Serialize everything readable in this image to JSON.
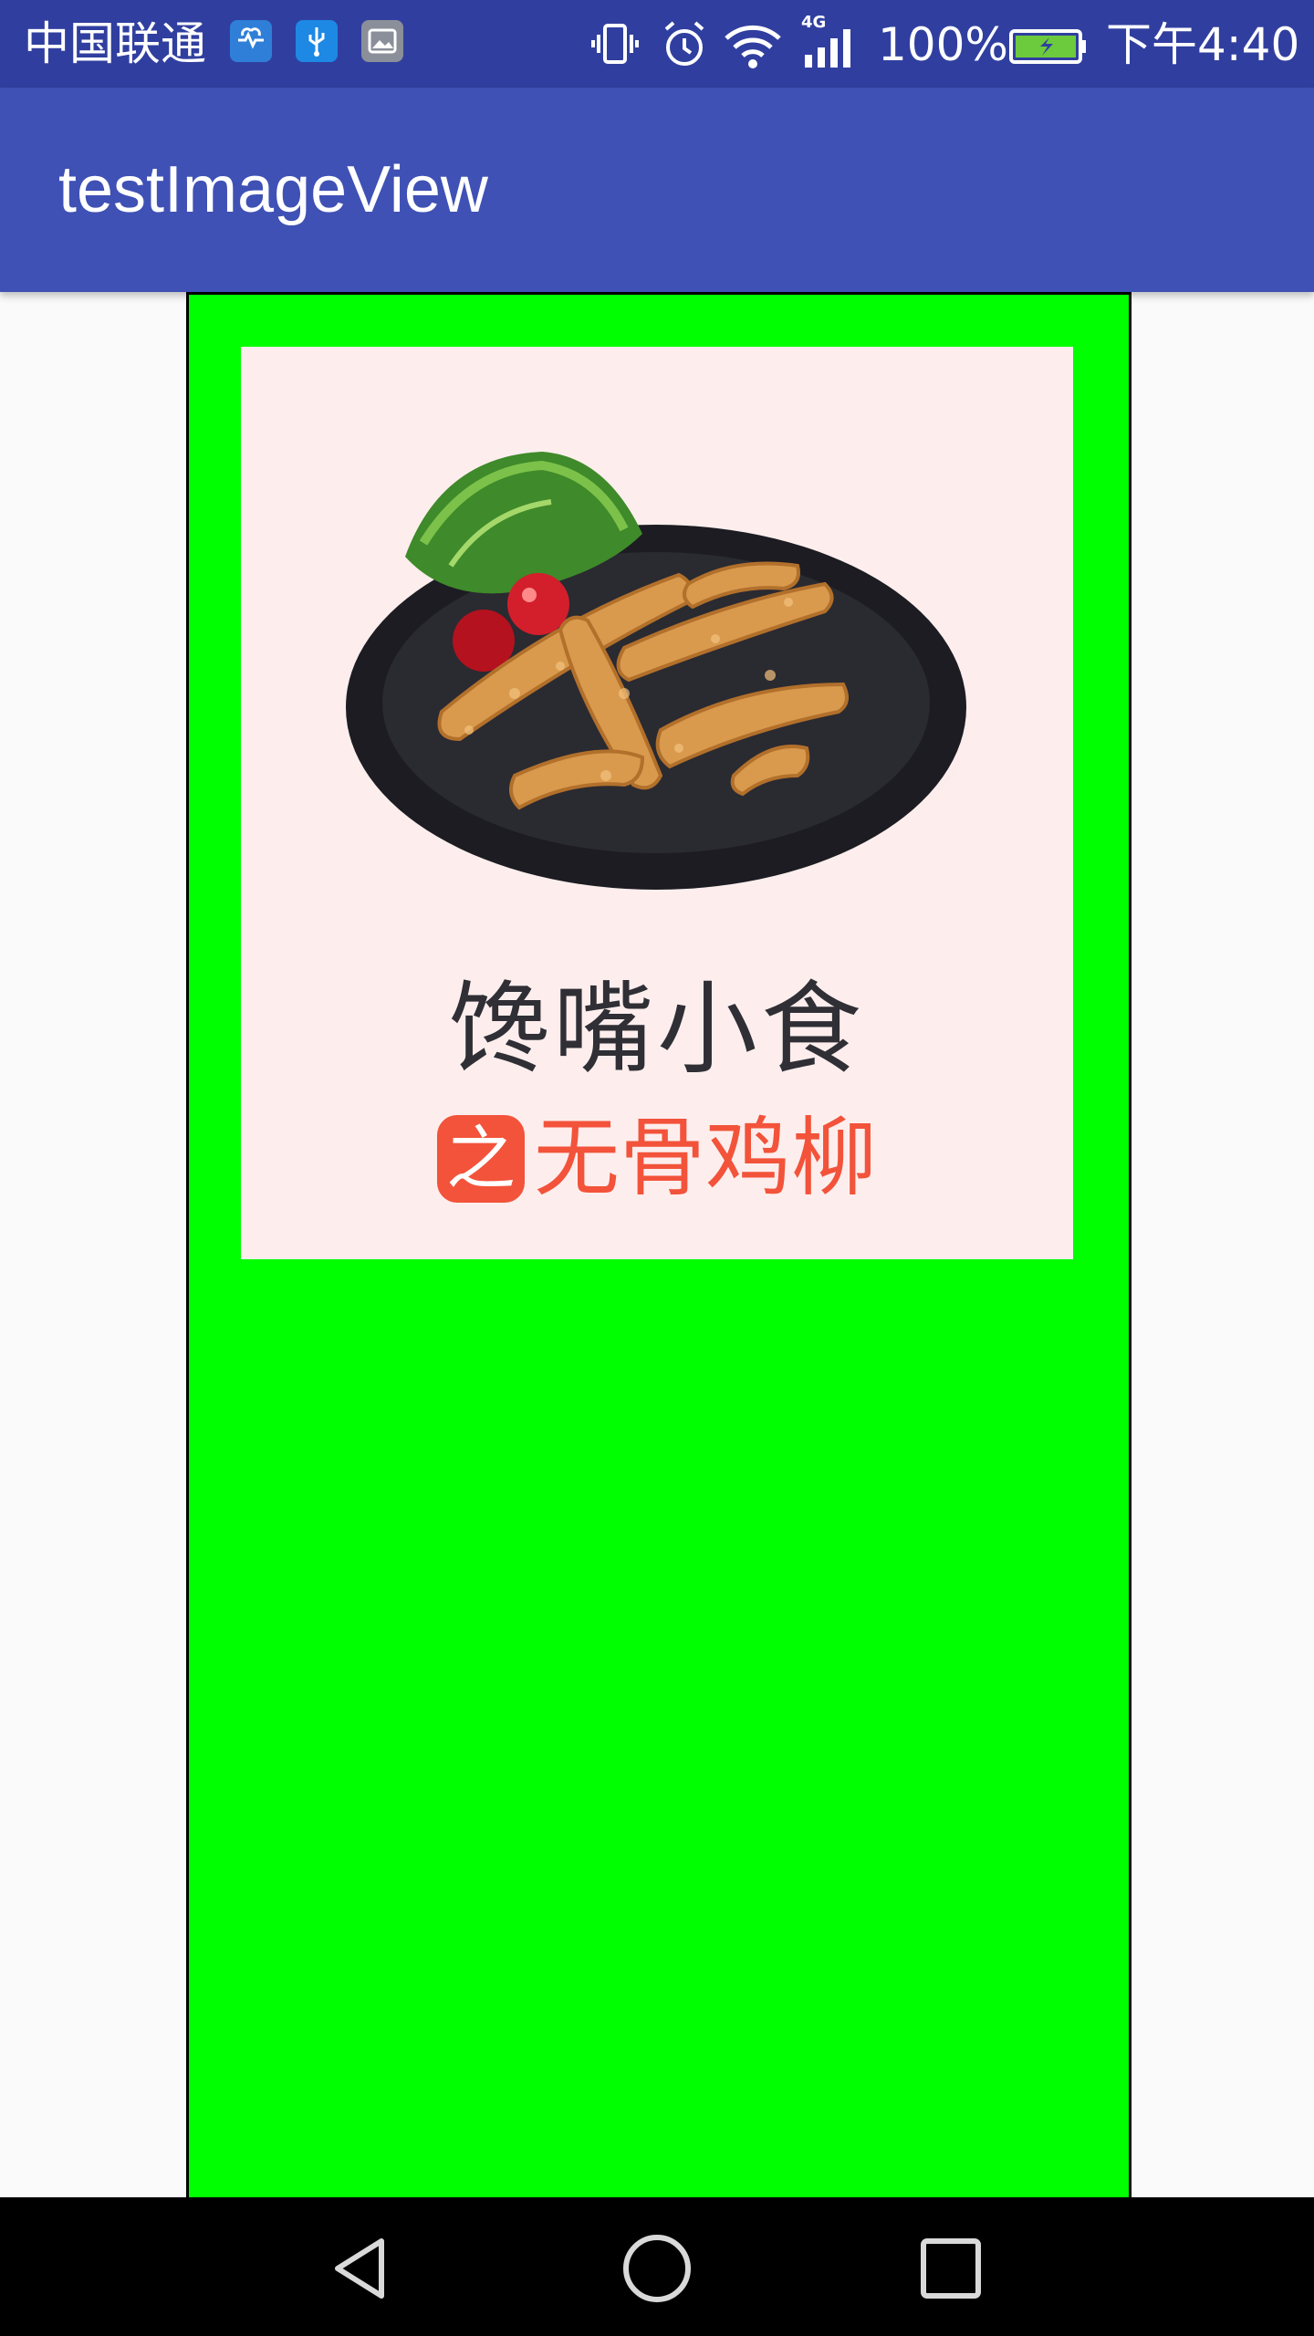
{
  "status_bar": {
    "carrier": "中国联通",
    "battery": "100%",
    "time": "下午4:40",
    "network": "4G",
    "icons": [
      "health-icon",
      "usb-icon",
      "gallery-icon",
      "vibrate-icon",
      "alarm-icon",
      "wifi-icon",
      "signal-icon",
      "battery-icon"
    ]
  },
  "app_bar": {
    "title": "testImageView"
  },
  "content": {
    "image_title": "馋嘴小食",
    "image_subtitle_badge": "之",
    "image_subtitle": "无骨鸡柳",
    "frame_color": "#00ff00",
    "image_bg": "#fdeeed"
  },
  "nav_bar": {
    "buttons": [
      "back-icon",
      "home-icon",
      "recents-icon"
    ]
  }
}
